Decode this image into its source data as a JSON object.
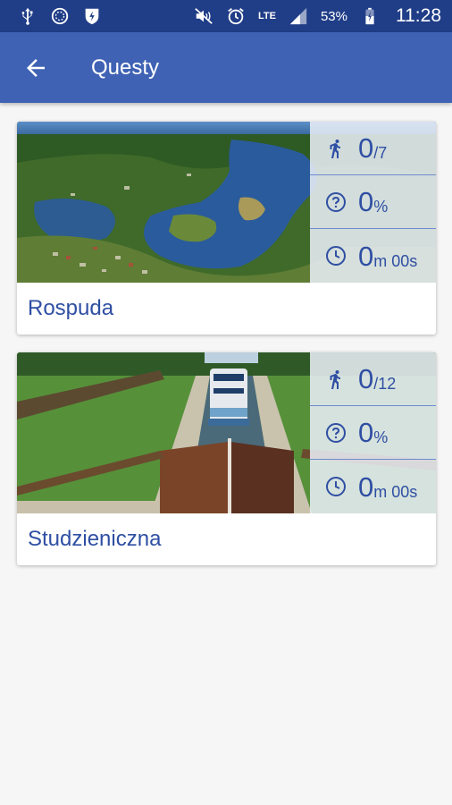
{
  "status_bar": {
    "battery": "53%",
    "time": "11:28",
    "network": "LTE",
    "icons": [
      "usb-icon",
      "navigation-icon",
      "shield-icon",
      "mute-icon",
      "alarm-icon",
      "signal-icon",
      "battery-icon"
    ]
  },
  "app_bar": {
    "title": "Questy",
    "back_icon": "arrow-back-icon",
    "color": "#3f62b4"
  },
  "quests": [
    {
      "name": "Rospuda",
      "image": "lake aerial view",
      "steps": "0",
      "steps_total": "/7",
      "percent": "0",
      "percent_unit": "%",
      "minutes": "0",
      "minutes_unit": "m",
      "seconds": "00s"
    },
    {
      "name": "Studzieniczna",
      "image": "canal lock with boat",
      "steps": "0",
      "steps_total": "/12",
      "percent": "0",
      "percent_unit": "%",
      "minutes": "0",
      "minutes_unit": "m",
      "seconds": "00s"
    }
  ],
  "colors": {
    "status_bar": "#203d87",
    "accent": "#2f4fa3",
    "background": "#f6f6f6"
  }
}
